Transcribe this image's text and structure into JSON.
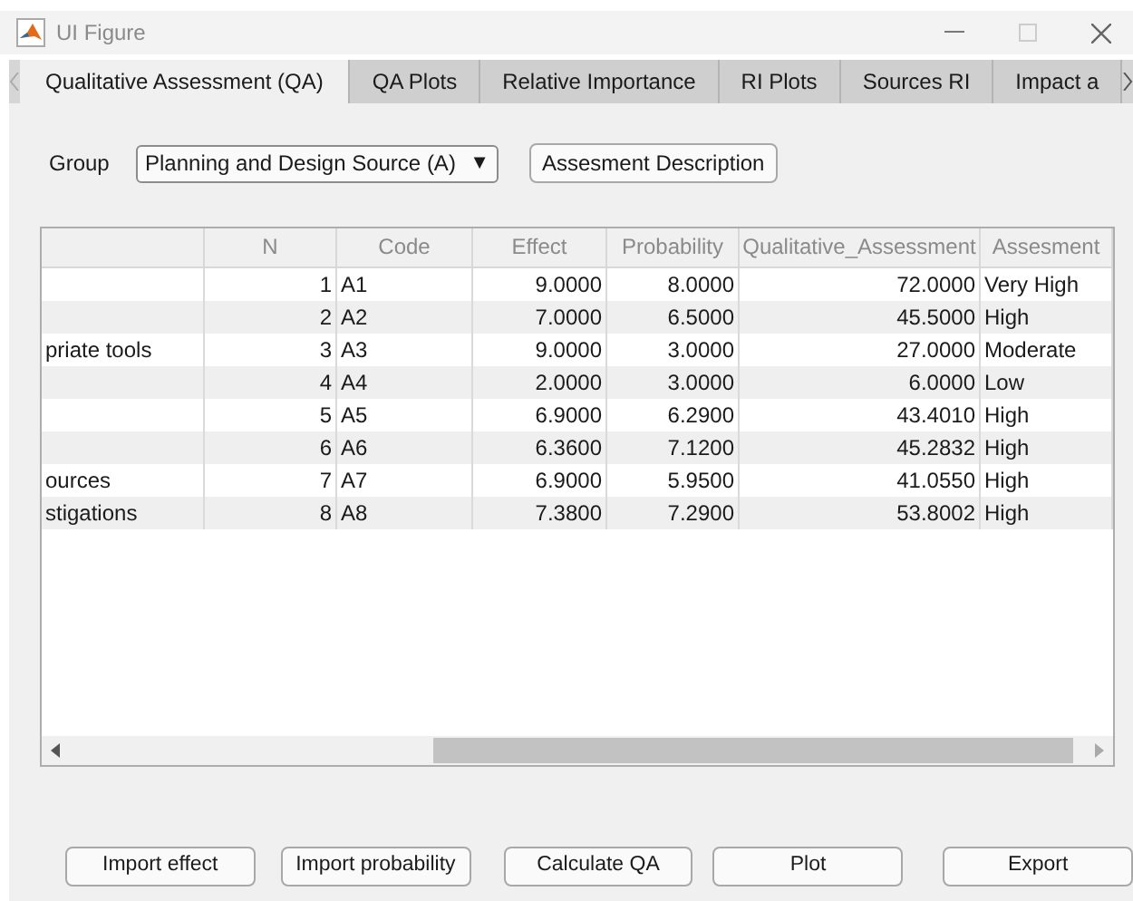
{
  "window": {
    "title": "UI Figure"
  },
  "tabs": [
    {
      "label": "Qualitative Assessment (QA)",
      "selected": true
    },
    {
      "label": "QA Plots",
      "selected": false
    },
    {
      "label": "Relative Importance",
      "selected": false
    },
    {
      "label": "RI Plots",
      "selected": false
    },
    {
      "label": "Sources RI",
      "selected": false
    },
    {
      "label": "Impact a",
      "selected": false
    }
  ],
  "group": {
    "label": "Group",
    "value": "Planning and Design Source (A)",
    "dropdown_arrow": "▼"
  },
  "description_button": "Assesment Description",
  "table": {
    "columns": [
      "N",
      "Code",
      "Effect",
      "Probability",
      "Qualitative_Assessment",
      "Assesment"
    ],
    "rows": [
      {
        "cells": [
          "1",
          "A1",
          "9.0000",
          "8.0000",
          "72.0000",
          "Very High"
        ]
      },
      {
        "cells": [
          "2",
          "A2",
          "7.0000",
          "6.5000",
          "45.5000",
          "High"
        ]
      },
      {
        "column_1": "priate tools",
        "cells": [
          "3",
          "A3",
          "9.0000",
          "3.0000",
          "27.0000",
          "Moderate"
        ]
      },
      {
        "cells": [
          "4",
          "A4",
          "2.0000",
          "3.0000",
          "6.0000",
          "Low"
        ]
      },
      {
        "cells": [
          "5",
          "A5",
          "6.9000",
          "6.2900",
          "43.4010",
          "High"
        ]
      },
      {
        "cells": [
          "6",
          "A6",
          "6.3600",
          "7.1200",
          "45.2832",
          "High"
        ]
      },
      {
        "column_1": "ources",
        "cells": [
          "7",
          "A7",
          "6.9000",
          "5.9500",
          "41.0550",
          "High"
        ]
      },
      {
        "column_1": "stigations",
        "cells": [
          "8",
          "A8",
          "7.3800",
          "7.2900",
          "53.8002",
          "High"
        ]
      }
    ]
  },
  "buttons": [
    "Import effect",
    "Import probability",
    "Calculate QA",
    "Plot",
    "Export"
  ]
}
